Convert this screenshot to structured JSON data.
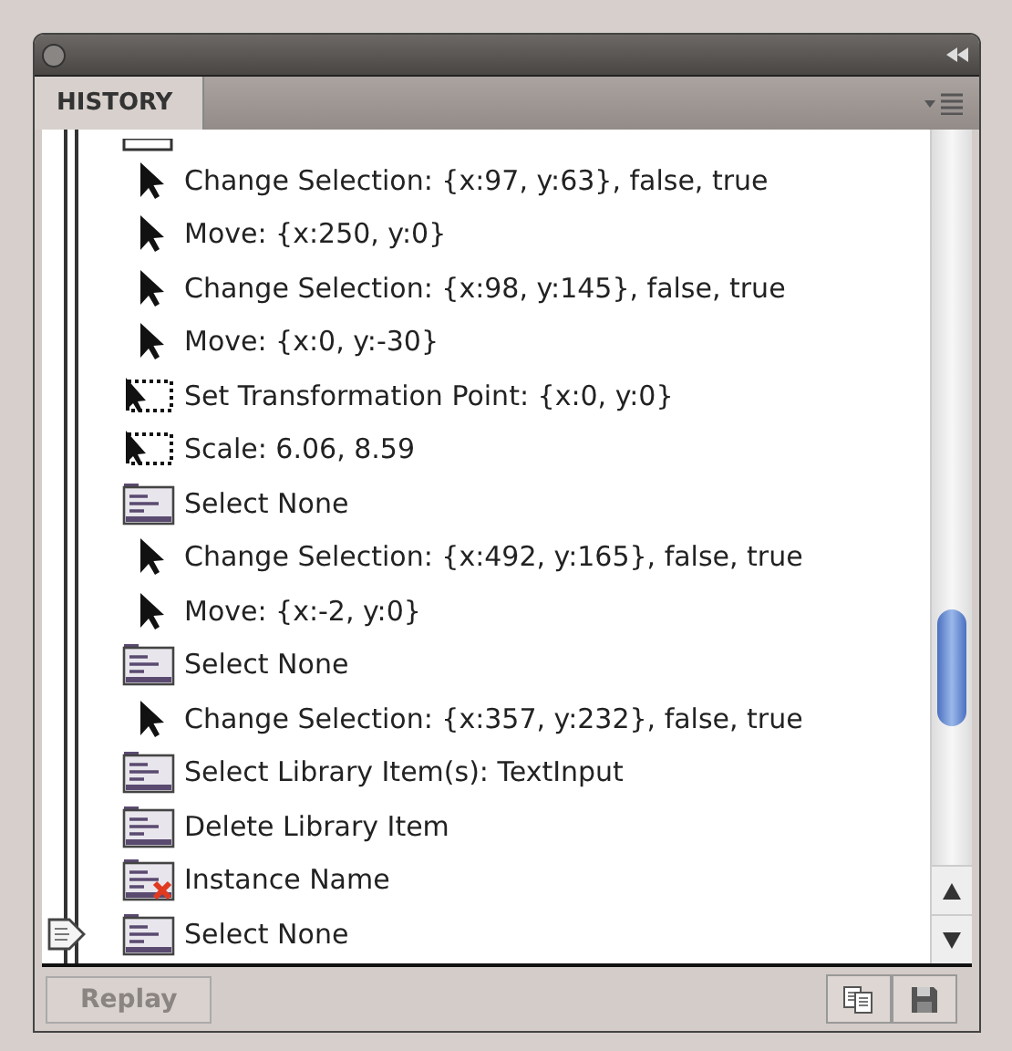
{
  "panel": {
    "tab": "HISTORY"
  },
  "steps": [
    {
      "kind": "pointer",
      "label": "Change Selection: {x:97, y:63}, false, true",
      "current": false
    },
    {
      "kind": "pointer",
      "label": "Move: {x:250, y:0}",
      "current": false
    },
    {
      "kind": "pointer",
      "label": "Change Selection: {x:98, y:145}, false, true",
      "current": false
    },
    {
      "kind": "pointer",
      "label": "Move: {x:0, y:-30}",
      "current": false
    },
    {
      "kind": "transform",
      "label": "Set Transformation Point: {x:0, y:0}",
      "current": false
    },
    {
      "kind": "transform",
      "label": "Scale: 6.06, 8.59",
      "current": false
    },
    {
      "kind": "document",
      "label": "Select None",
      "current": false
    },
    {
      "kind": "pointer",
      "label": "Change Selection: {x:492, y:165}, false, true",
      "current": false
    },
    {
      "kind": "pointer",
      "label": "Move: {x:-2, y:0}",
      "current": false
    },
    {
      "kind": "document",
      "label": "Select None",
      "current": false
    },
    {
      "kind": "pointer",
      "label": "Change Selection: {x:357, y:232}, false, true",
      "current": false
    },
    {
      "kind": "document",
      "label": "Select Library Item(s): TextInput",
      "current": false
    },
    {
      "kind": "document",
      "label": "Delete Library Item",
      "current": false
    },
    {
      "kind": "document-error",
      "label": "Instance Name",
      "current": false
    },
    {
      "kind": "document",
      "label": "Select None",
      "current": true
    }
  ],
  "footer": {
    "replay": "Replay",
    "replay_disabled": true
  }
}
